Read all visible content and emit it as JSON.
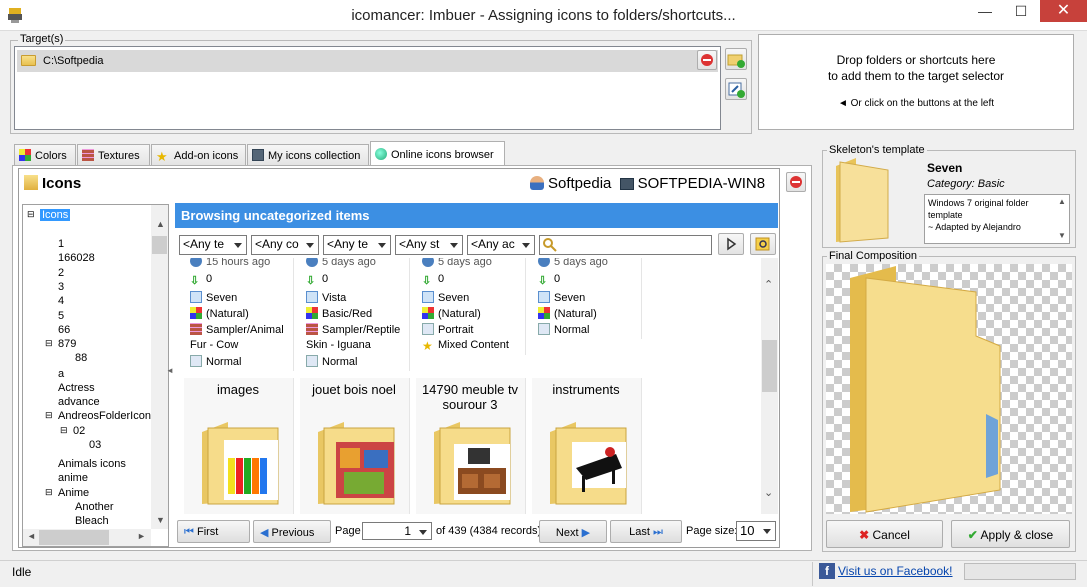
{
  "window": {
    "title": "icomancer: Imbuer - Assigning icons to folders/shortcuts...",
    "minimize": "—",
    "maximize": "☐",
    "close": "✕"
  },
  "target": {
    "label": "Target(s)",
    "path": "C:\\Softpedia"
  },
  "drop_zone": {
    "line1": "Drop folders or shortcuts here",
    "line2": "to add them to the target selector",
    "hint": "◄ Or click on the buttons at the left"
  },
  "tabs": [
    {
      "label": "Colors"
    },
    {
      "label": "Textures"
    },
    {
      "label": "Add-on icons"
    },
    {
      "label": "My icons collection"
    },
    {
      "label": "Online icons browser"
    }
  ],
  "browser": {
    "header": "Icons",
    "user": "Softpedia",
    "machine": "SOFTPEDIA-WIN8",
    "section_title": "Browsing uncategorized items",
    "filters": [
      "<Any te",
      "<Any co",
      "<Any te",
      "<Any st",
      "<Any ac"
    ],
    "search_value": ""
  },
  "tree": {
    "root": "Icons",
    "items": [
      "1",
      "166028",
      "2",
      "3",
      "4",
      "5",
      "66",
      "879",
      "88",
      "a",
      "Actress",
      "advance",
      "AndreosFolderIcons",
      "02",
      "03",
      "Animals icons",
      "anime",
      "Anime",
      "Another",
      "Bleach"
    ]
  },
  "cards_top": [
    {
      "time": "15 hours ago",
      "count": "0",
      "os": "Seven",
      "style": "(Natural)",
      "template": "Sampler/Animal",
      "template2": "Fur - Cow",
      "mode": "Normal"
    },
    {
      "time": "5 days ago",
      "count": "0",
      "os": "Vista",
      "style": "Basic/Red",
      "template": "Sampler/Reptile",
      "template2": "Skin - Iguana",
      "mode": "Normal"
    },
    {
      "time": "5 days ago",
      "count": "0",
      "os": "Seven",
      "style": "(Natural)",
      "template": "Portrait",
      "template2": "",
      "mode": "Mixed Content"
    },
    {
      "time": "5 days ago",
      "count": "0",
      "os": "Seven",
      "style": "(Natural)",
      "template": "Normal",
      "template2": "",
      "mode": ""
    }
  ],
  "cards_bottom": [
    {
      "title": "images"
    },
    {
      "title": "jouet bois noel"
    },
    {
      "title": "14790 meuble tv sourour 3"
    },
    {
      "title": "instruments"
    }
  ],
  "pager": {
    "first": "First",
    "previous": "Previous",
    "page_label": "Page",
    "page_value": "1",
    "of_text": "of 439 (4384 records)",
    "next": "Next",
    "last": "Last",
    "page_size_label": "Page size:",
    "page_size": "10"
  },
  "skeleton": {
    "label": "Skeleton's template",
    "name": "Seven",
    "category": "Category: Basic",
    "description": "Windows 7 original folder template\n~ Adapted by Alejandro"
  },
  "final": {
    "label": "Final Composition"
  },
  "actions": {
    "cancel": "Cancel",
    "apply": "Apply & close"
  },
  "status": {
    "text": "Idle",
    "facebook": "Visit us on Facebook!"
  },
  "colors": {
    "accent": "#3c8fe3",
    "close": "#c7413b"
  }
}
